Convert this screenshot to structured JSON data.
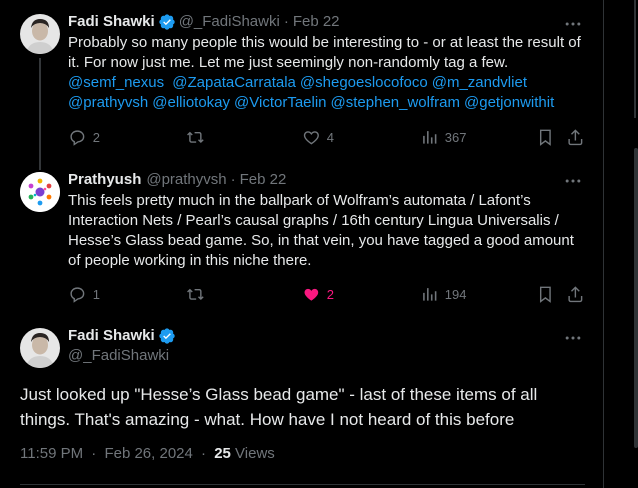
{
  "tweets": [
    {
      "name": "Fadi Shawki",
      "handle": "@_FadiShawki",
      "date": "Feb 22",
      "text": "Probably so many people this would be interesting to - or at least the result of it. For now just me. Let me just seemingly non-randomly tag a few.",
      "mentions": [
        "@semf_nexus",
        "@ZapataCarratala",
        "@shegoeslocofoco",
        "@m_zandvliet",
        "@prathyvsh",
        "@elliotokay",
        "@VictorTaelin",
        "@stephen_wolfram",
        "@getjonwithit"
      ],
      "replies": "2",
      "retweets": "",
      "likes": "4",
      "views": "367"
    },
    {
      "name": "Prathyush",
      "handle": "@prathyvsh",
      "date": "Feb 22",
      "text": "This feels pretty much in the ballpark of Wolfram’s automata / Lafont’s Interaction Nets / Pearl’s causal graphs / 16th century Lingua Universalis / Hesse’s Glass bead game. So, in that vein, you have tagged a good amount of people working in this niche there.",
      "replies": "1",
      "retweets": "",
      "likes": "2",
      "views": "194"
    }
  ],
  "main": {
    "name": "Fadi Shawki",
    "handle": "@_FadiShawki",
    "text": "Just looked up \"Hesse’s Glass bead game\" - last of these items of all things. That's amazing - what. How have I not heard of this before",
    "time": "11:59 PM",
    "date": "Feb 26, 2024",
    "views_count": "25",
    "views_label": "Views"
  },
  "colors": {
    "accent": "#1d9bf0",
    "like": "#f91880",
    "muted": "#71767b"
  },
  "icons": [
    "verified-icon",
    "more-icon",
    "reply-icon",
    "retweet-icon",
    "like-icon",
    "views-icon",
    "bookmark-icon",
    "share-icon"
  ]
}
